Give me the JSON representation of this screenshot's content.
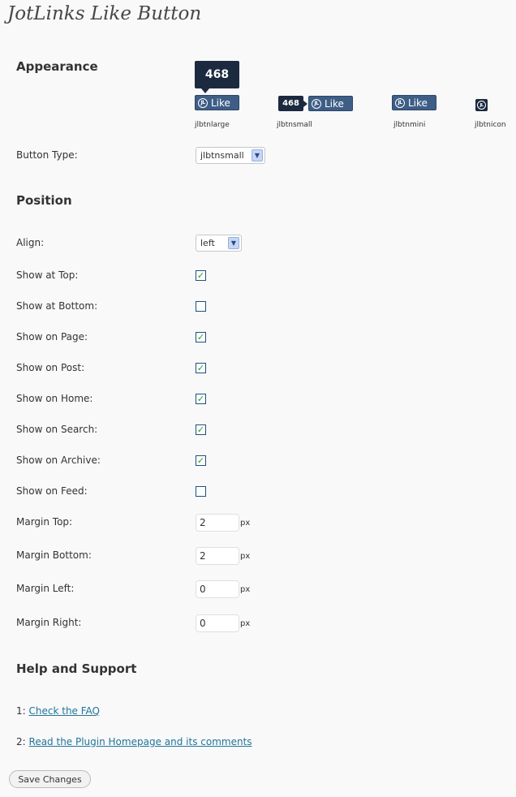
{
  "title": "JotLinks Like Button",
  "appearance": {
    "heading": "Appearance",
    "count": "468",
    "like_label": "Like",
    "icon_text": "JL",
    "button_styles": [
      "jlbtnlarge",
      "jlbtnsmall",
      "jlbtnmini",
      "jlbtnicon"
    ],
    "button_type_label": "Button Type:",
    "button_type_value": "jlbtnsmall"
  },
  "position": {
    "heading": "Position",
    "align_label": "Align:",
    "align_value": "left",
    "checkboxes": [
      {
        "label": "Show at Top:",
        "checked": true
      },
      {
        "label": "Show at Bottom:",
        "checked": false
      },
      {
        "label": "Show on Page:",
        "checked": true
      },
      {
        "label": "Show on Post:",
        "checked": true
      },
      {
        "label": "Show on Home:",
        "checked": true
      },
      {
        "label": "Show on Search:",
        "checked": true
      },
      {
        "label": "Show on Archive:",
        "checked": true
      },
      {
        "label": "Show on Feed:",
        "checked": false
      }
    ],
    "margins": [
      {
        "label": "Margin Top:",
        "value": "2"
      },
      {
        "label": "Margin Bottom:",
        "value": "2"
      },
      {
        "label": "Margin Left:",
        "value": "0"
      },
      {
        "label": "Margin Right:",
        "value": "0"
      }
    ],
    "unit": "px"
  },
  "help": {
    "heading": "Help and Support",
    "items": [
      {
        "prefix": "1:",
        "link": "Check the FAQ"
      },
      {
        "prefix": "2:",
        "link": "Read the Plugin Homepage and its comments"
      }
    ]
  },
  "save_label": "Save Changes",
  "colors": {
    "like_button": "#3e5e86",
    "count_box": "#1b2a3e",
    "link": "#21759b",
    "check": "#21a121"
  }
}
